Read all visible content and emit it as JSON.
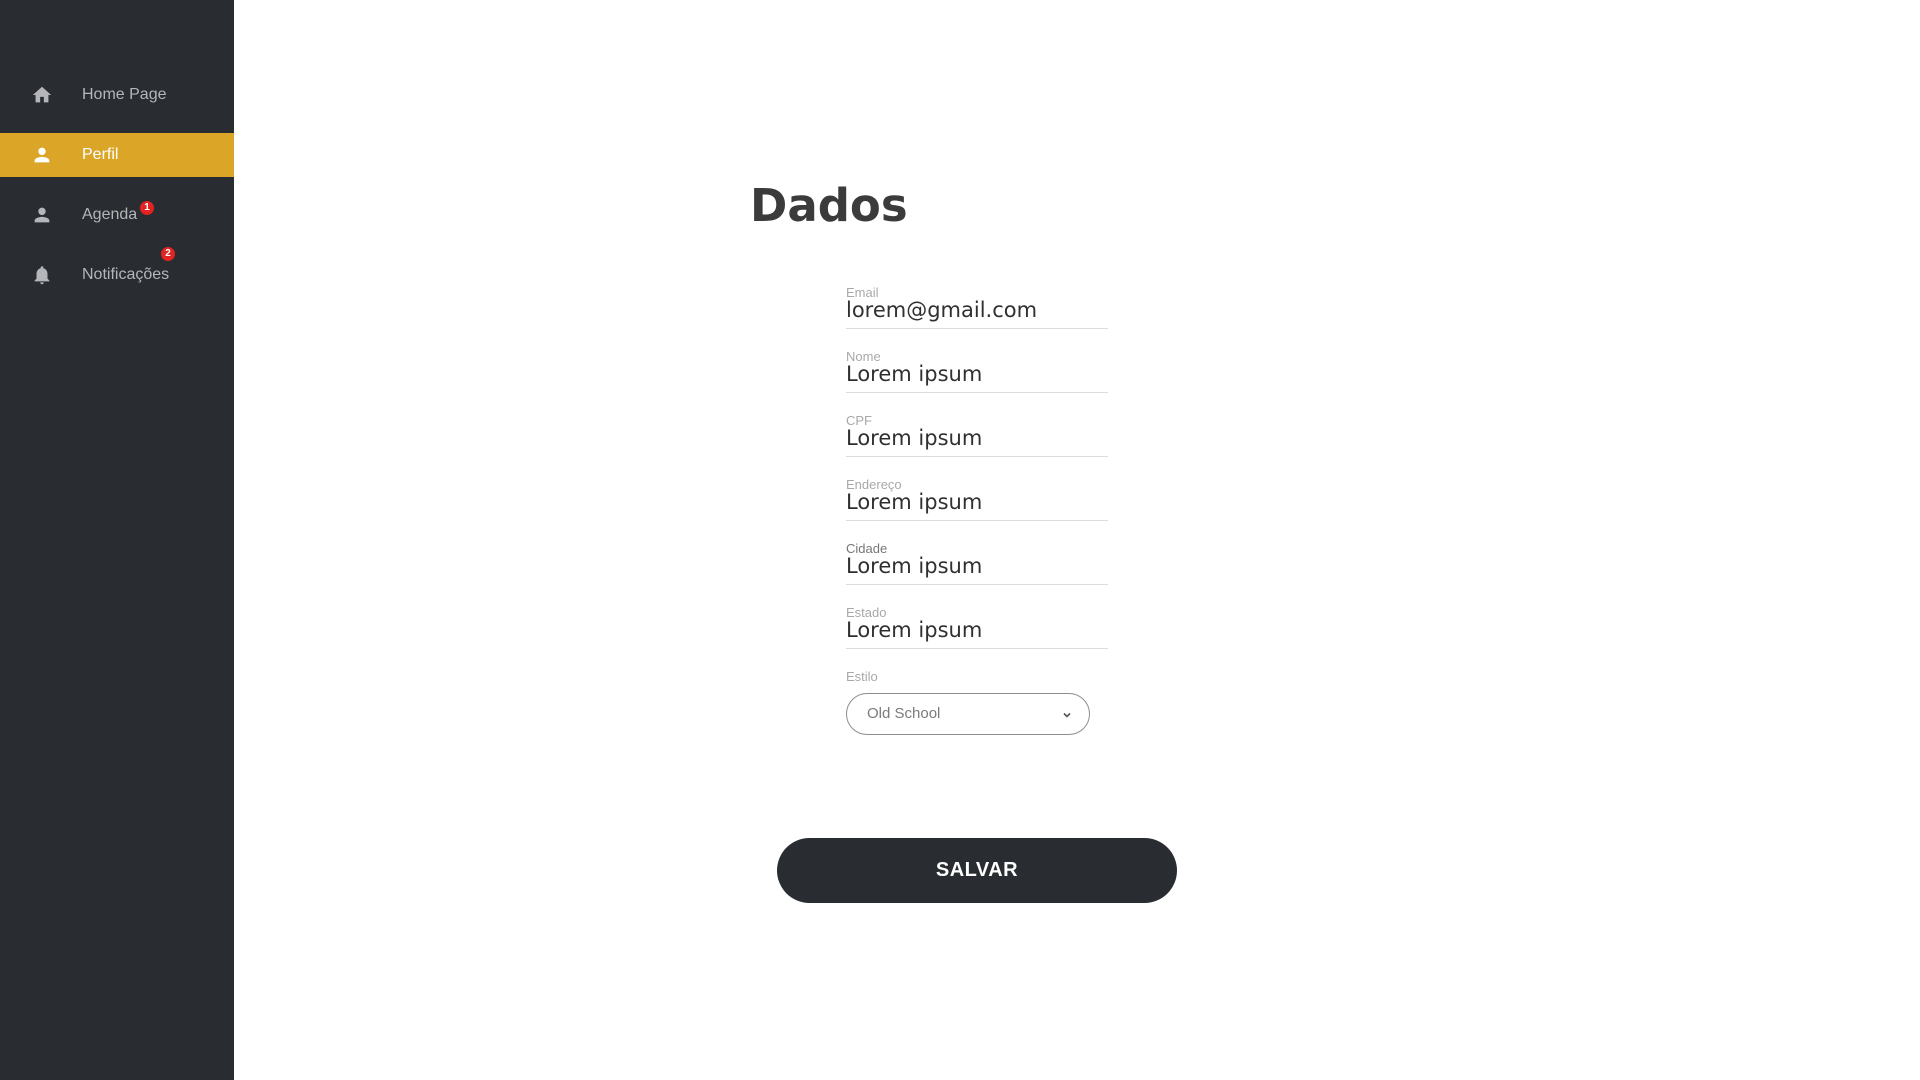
{
  "sidebar": {
    "items": [
      {
        "label": "Home Page",
        "icon": "home-icon",
        "active": false
      },
      {
        "label": "Perfil",
        "icon": "user-icon",
        "active": true
      },
      {
        "label": "Agenda",
        "icon": "user-icon",
        "badge": "1",
        "active": false
      },
      {
        "label": "Notificações",
        "icon": "bell-icon",
        "badge": "2",
        "active": false
      }
    ],
    "background": "#292c30",
    "active_color": "#dba628",
    "badge_color": "#e02424"
  },
  "main": {
    "title": "Dados",
    "fields": [
      {
        "label": "Email",
        "value": "lorem@gmail.com"
      },
      {
        "label": "Nome",
        "value": "Lorem ipsum"
      },
      {
        "label": "CPF",
        "value": "Lorem ipsum"
      },
      {
        "label": "Endereço",
        "value": "Lorem ipsum"
      },
      {
        "label": "Cidade",
        "value": "Lorem ipsum"
      },
      {
        "label": "Estado",
        "value": "Lorem ipsum"
      }
    ],
    "style_field": {
      "label": "Estilo",
      "value": "Old School",
      "icon": "chevron-down-icon"
    },
    "save_label": "SALVAR"
  }
}
